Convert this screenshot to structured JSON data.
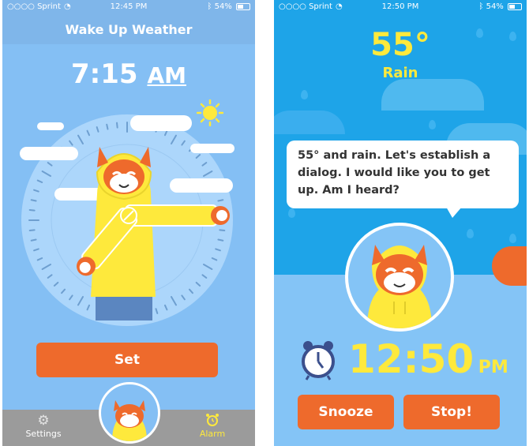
{
  "left_screen": {
    "status": {
      "carrier": "○○○○ Sprint",
      "time": "12:45 PM",
      "battery": "54%"
    },
    "header": {
      "title": "Wake Up Weather"
    },
    "alarm_time": {
      "time": "7:15",
      "ampm": "AM"
    },
    "set_button": {
      "label": "Set"
    },
    "tabbar": {
      "settings_label": "Settings",
      "alarm_label": "Alarm"
    }
  },
  "right_screen": {
    "status": {
      "carrier": "○○○○ Sprint",
      "time": "12:50 PM",
      "battery": "54%"
    },
    "weather": {
      "temperature": "55°",
      "condition": "Rain"
    },
    "speech": {
      "text": "55° and rain. Let's establish a dialog. I would like you to get up. Am I heard?"
    },
    "clock": {
      "time": "12:50",
      "ampm": "PM"
    },
    "buttons": {
      "snooze_label": "Snooze",
      "stop_label": "Stop!"
    }
  },
  "colors": {
    "left_bg": "#84bff4",
    "right_bg": "#1ea4e8",
    "accent_orange": "#ee6a2c",
    "yellow": "#fee93c",
    "tabbar_gray": "#9b9b9b"
  },
  "icons": [
    "wifi-icon",
    "bluetooth-icon",
    "battery-icon",
    "sun-icon",
    "gear-icon",
    "alarm-clock-icon",
    "clock-icon"
  ]
}
